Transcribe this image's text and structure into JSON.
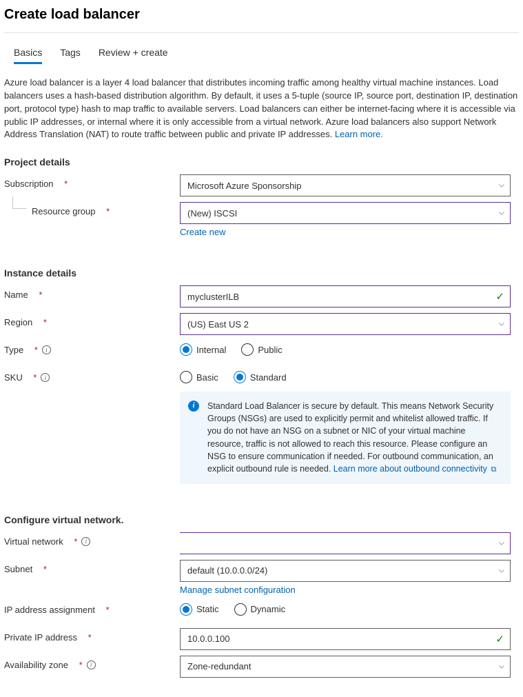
{
  "header": {
    "title": "Create load balancer"
  },
  "tabs": {
    "basics": "Basics",
    "tags": "Tags",
    "review": "Review + create"
  },
  "intro": {
    "text": "Azure load balancer is a layer 4 load balancer that distributes incoming traffic among healthy virtual machine instances. Load balancers uses a hash-based distribution algorithm. By default, it uses a 5-tuple (source IP, source port, destination IP, destination port, protocol type) hash to map traffic to available servers. Load balancers can either be internet-facing where it is accessible via public IP addresses, or internal where it is only accessible from a virtual network. Azure load balancers also support Network Address Translation (NAT) to route traffic between public and private IP addresses.  ",
    "learn_more": "Learn more."
  },
  "sections": {
    "project": "Project details",
    "instance": "Instance details",
    "vnet": "Configure virtual network."
  },
  "labels": {
    "subscription": "Subscription",
    "resource_group": "Resource group",
    "name": "Name",
    "region": "Region",
    "type": "Type",
    "sku": "SKU",
    "virtual_network": "Virtual network",
    "subnet": "Subnet",
    "ip_assignment": "IP address assignment",
    "private_ip": "Private IP address",
    "avail_zone": "Availability zone"
  },
  "values": {
    "subscription": "Microsoft Azure Sponsorship",
    "resource_group": "(New) ISCSI",
    "name": "myclusterILB",
    "region": "(US) East US 2",
    "virtual_network": "",
    "subnet": "default (10.0.0.0/24)",
    "private_ip": "10.0.0.100",
    "avail_zone": "Zone-redundant"
  },
  "links": {
    "create_new": "Create new",
    "manage_subnet": "Manage subnet configuration",
    "outbound_learn": "Learn more about outbound connectivity"
  },
  "radios": {
    "type_internal": "Internal",
    "type_public": "Public",
    "sku_basic": "Basic",
    "sku_standard": "Standard",
    "ip_static": "Static",
    "ip_dynamic": "Dynamic"
  },
  "infobox": {
    "text": "Standard Load Balancer is secure by default.  This means Network Security Groups (NSGs) are used to explicitly permit and whitelist allowed traffic. If you do not have an NSG on a subnet or NIC of your virtual machine resource, traffic is not allowed to reach this resource. Please configure an NSG to ensure communication if needed.  For outbound communication, an explicit outbound rule is needed.  "
  }
}
